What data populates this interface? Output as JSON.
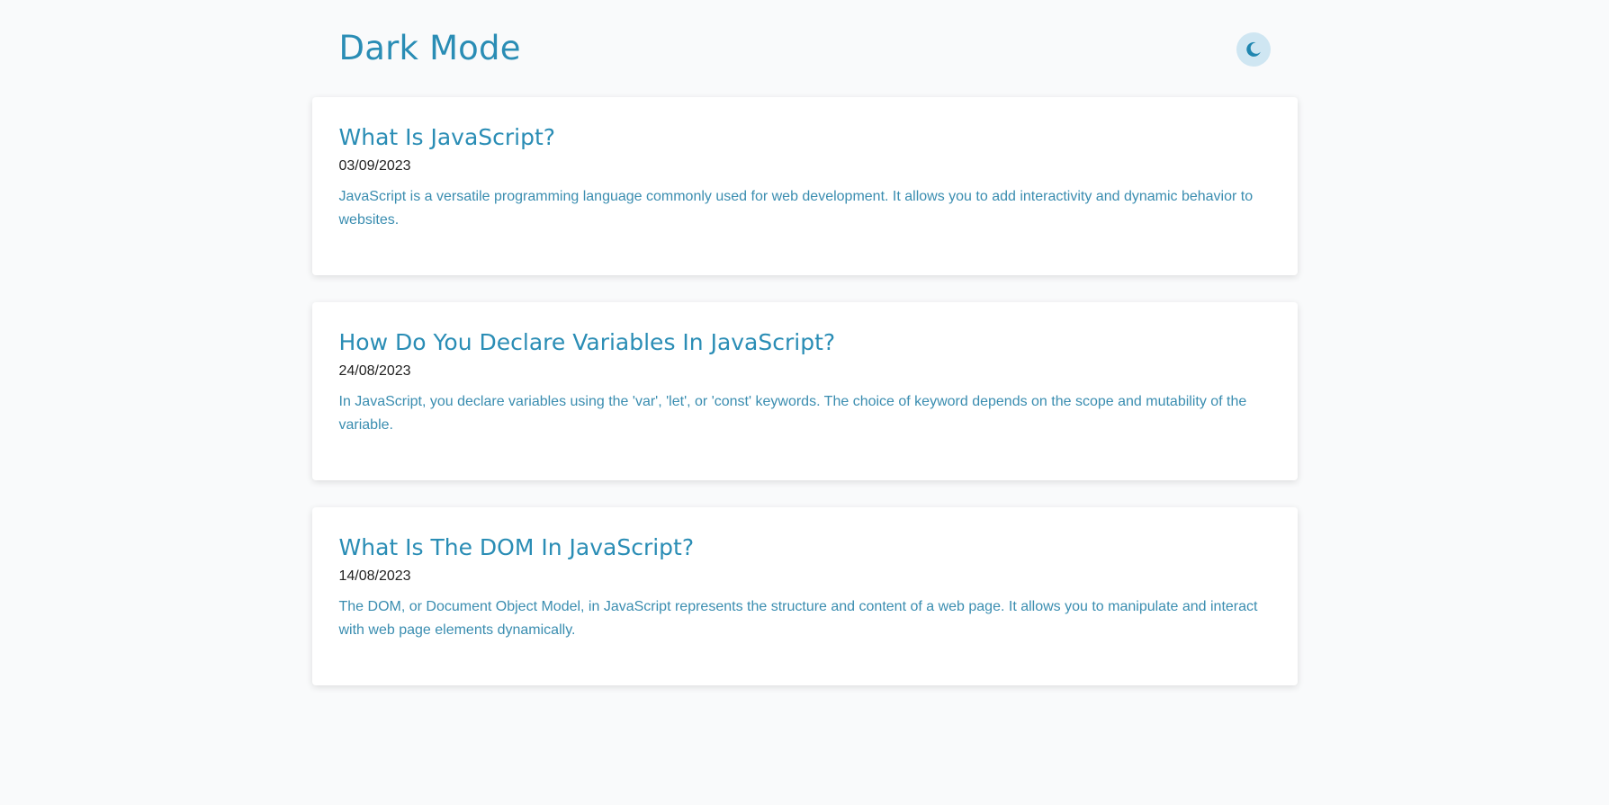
{
  "header": {
    "title": "Dark Mode",
    "theme_toggle_icon": "moon-icon"
  },
  "colors": {
    "accent": "#2a8db5",
    "toggle_bg": "#cfe6f2",
    "background": "#f9fafb",
    "card": "#ffffff",
    "date_text": "#222222"
  },
  "posts": [
    {
      "title": "What Is JavaScript?",
      "date": "03/09/2023",
      "excerpt": "JavaScript is a versatile programming language commonly used for web development. It allows you to add interactivity and dynamic behavior to websites."
    },
    {
      "title": "How Do You Declare Variables In JavaScript?",
      "date": "24/08/2023",
      "excerpt": "In JavaScript, you declare variables using the 'var', 'let', or 'const' keywords. The choice of keyword depends on the scope and mutability of the variable."
    },
    {
      "title": "What Is The DOM In JavaScript?",
      "date": "14/08/2023",
      "excerpt": "The DOM, or Document Object Model, in JavaScript represents the structure and content of a web page. It allows you to manipulate and interact with web page elements dynamically."
    }
  ]
}
